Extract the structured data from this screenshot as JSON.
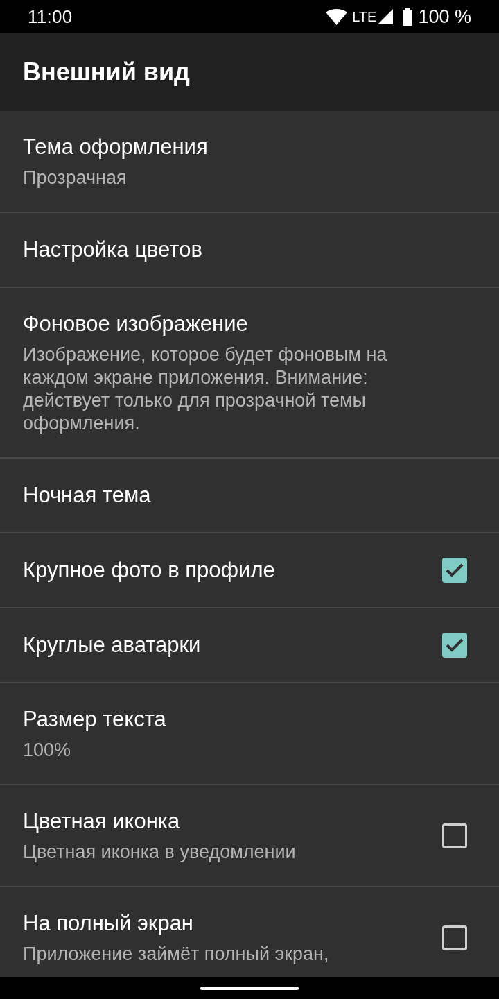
{
  "status_bar": {
    "time": "11:00",
    "network": "LTE",
    "battery": "100 %"
  },
  "app_bar": {
    "title": "Внешний вид"
  },
  "preferences": [
    {
      "kind": "text",
      "title": "Тема оформления",
      "summary": "Прозрачная"
    },
    {
      "kind": "text",
      "title": "Настройка цветов"
    },
    {
      "kind": "text",
      "title": "Фоновое изображение",
      "summary": "Изображение, которое будет фоновым на каждом экране приложения. Внимание: действует только для прозрачной темы оформления."
    },
    {
      "kind": "text",
      "title": "Ночная тема"
    },
    {
      "kind": "checkbox",
      "title": "Крупное фото в профиле",
      "checked": true
    },
    {
      "kind": "checkbox",
      "title": "Круглые аватарки",
      "checked": true
    },
    {
      "kind": "text",
      "title": "Размер текста",
      "summary": "100%"
    },
    {
      "kind": "checkbox",
      "title": "Цветная иконка",
      "summary": "Цветная иконка в уведомлении",
      "checked": false
    },
    {
      "kind": "checkbox",
      "title": "На полный экран",
      "summary": "Приложение займёт полный экран,",
      "checked": false
    }
  ]
}
